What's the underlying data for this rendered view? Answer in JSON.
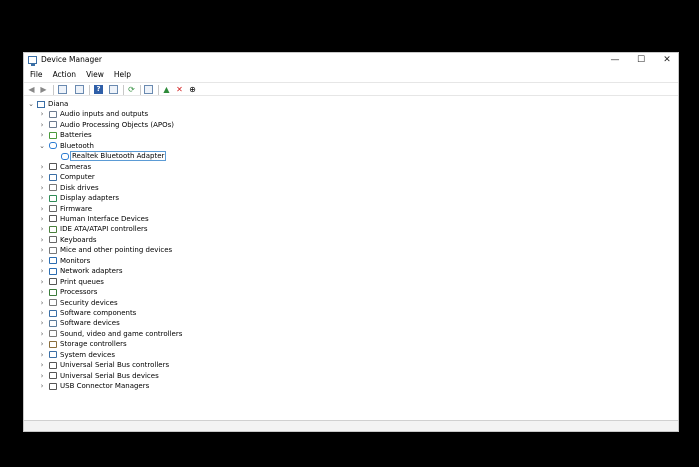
{
  "window": {
    "title": "Device Manager",
    "minimize_glyph": "—",
    "maximize_glyph": "☐",
    "close_glyph": "✕"
  },
  "menubar": {
    "items": [
      "File",
      "Action",
      "View",
      "Help"
    ]
  },
  "toolbar": {
    "buttons": [
      "back-icon",
      "forward-icon",
      "properties-pane-icon",
      "list-icon",
      "help-icon",
      "details-icon",
      "update-driver-icon",
      "scan-hardware-icon",
      "enable-device-icon",
      "uninstall-device-icon",
      "download-driver-icon"
    ]
  },
  "tree": {
    "root": "Diana",
    "categories": [
      {
        "label": "Audio inputs and outputs",
        "icon": "speaker-icon"
      },
      {
        "label": "Audio Processing Objects (APOs)",
        "icon": "speaker-icon"
      },
      {
        "label": "Batteries",
        "icon": "battery-icon"
      },
      {
        "label": "Bluetooth",
        "icon": "bluetooth-icon",
        "expanded": true,
        "children": [
          {
            "label": "Realtek Bluetooth Adapter",
            "selected": true
          }
        ]
      },
      {
        "label": "Cameras",
        "icon": "camera-icon"
      },
      {
        "label": "Computer",
        "icon": "computer-icon"
      },
      {
        "label": "Disk drives",
        "icon": "disk-icon"
      },
      {
        "label": "Display adapters",
        "icon": "display-icon"
      },
      {
        "label": "Firmware",
        "icon": "firmware-icon"
      },
      {
        "label": "Human Interface Devices",
        "icon": "hid-icon"
      },
      {
        "label": "IDE ATA/ATAPI controllers",
        "icon": "ide-icon"
      },
      {
        "label": "Keyboards",
        "icon": "keyboard-icon"
      },
      {
        "label": "Mice and other pointing devices",
        "icon": "mouse-icon"
      },
      {
        "label": "Monitors",
        "icon": "monitor-icon"
      },
      {
        "label": "Network adapters",
        "icon": "network-icon"
      },
      {
        "label": "Print queues",
        "icon": "printer-icon"
      },
      {
        "label": "Processors",
        "icon": "processor-icon"
      },
      {
        "label": "Security devices",
        "icon": "security-icon"
      },
      {
        "label": "Software components",
        "icon": "software-component-icon"
      },
      {
        "label": "Software devices",
        "icon": "software-device-icon"
      },
      {
        "label": "Sound, video and game controllers",
        "icon": "sound-icon"
      },
      {
        "label": "Storage controllers",
        "icon": "storage-icon"
      },
      {
        "label": "System devices",
        "icon": "system-icon"
      },
      {
        "label": "Universal Serial Bus controllers",
        "icon": "usb-icon"
      },
      {
        "label": "Universal Serial Bus devices",
        "icon": "usb-icon"
      },
      {
        "label": "USB Connector Managers",
        "icon": "usb-icon"
      }
    ]
  }
}
